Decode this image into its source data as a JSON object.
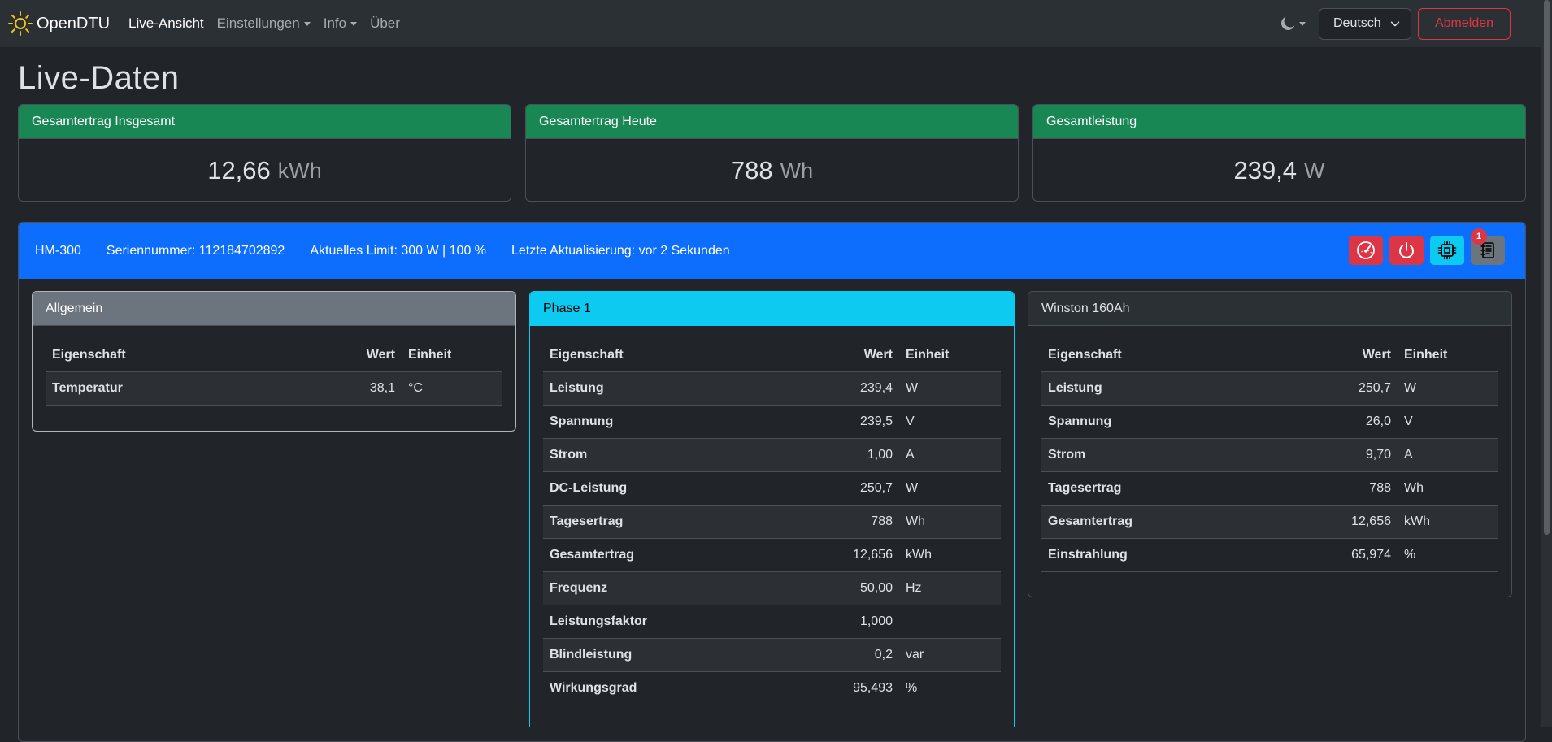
{
  "app": {
    "brand": "OpenDTU"
  },
  "nav": {
    "items": [
      {
        "label": "Live-Ansicht",
        "active": true,
        "dropdown": false
      },
      {
        "label": "Einstellungen",
        "active": false,
        "dropdown": true
      },
      {
        "label": "Info",
        "active": false,
        "dropdown": true
      },
      {
        "label": "Über",
        "active": false,
        "dropdown": false
      }
    ],
    "language": "Deutsch",
    "logout_label": "Abmelden",
    "theme_icon": "moon-icon"
  },
  "page": {
    "title": "Live-Daten"
  },
  "summary": [
    {
      "title": "Gesamtertrag Insgesamt",
      "value": "12,66",
      "unit": "kWh"
    },
    {
      "title": "Gesamtertrag Heute",
      "value": "788",
      "unit": "Wh"
    },
    {
      "title": "Gesamtleistung",
      "value": "239,4",
      "unit": "W"
    }
  ],
  "inverter": {
    "model": "HM-300",
    "serial": "Seriennummer: 112184702892",
    "limit": "Aktuelles Limit: 300 W | 100 %",
    "updated": "Letzte Aktualisierung: vor 2 Sekunden",
    "actions": [
      {
        "icon": "speedometer-icon",
        "color": "#dc3545"
      },
      {
        "icon": "power-icon",
        "color": "#dc3545"
      },
      {
        "icon": "cpu-icon",
        "color": "#0dcaf0"
      },
      {
        "icon": "journal-icon",
        "color": "#6c757d",
        "badge": "1"
      }
    ]
  },
  "cards": [
    {
      "title": "Allgemein",
      "headers": [
        "Eigenschaft",
        "Wert",
        "Einheit"
      ],
      "rows": [
        [
          "Temperatur",
          "38,1",
          "°C"
        ]
      ]
    },
    {
      "title": "Phase 1",
      "headers": [
        "Eigenschaft",
        "Wert",
        "Einheit"
      ],
      "rows": [
        [
          "Leistung",
          "239,4",
          "W"
        ],
        [
          "Spannung",
          "239,5",
          "V"
        ],
        [
          "Strom",
          "1,00",
          "A"
        ],
        [
          "DC-Leistung",
          "250,7",
          "W"
        ],
        [
          "Tagesertrag",
          "788",
          "Wh"
        ],
        [
          "Gesamtertrag",
          "12,656",
          "kWh"
        ],
        [
          "Frequenz",
          "50,00",
          "Hz"
        ],
        [
          "Leistungsfaktor",
          "1,000",
          ""
        ],
        [
          "Blindleistung",
          "0,2",
          "var"
        ],
        [
          "Wirkungsgrad",
          "95,493",
          "%"
        ]
      ]
    },
    {
      "title": "Winston 160Ah",
      "headers": [
        "Eigenschaft",
        "Wert",
        "Einheit"
      ],
      "rows": [
        [
          "Leistung",
          "250,7",
          "W"
        ],
        [
          "Spannung",
          "26,0",
          "V"
        ],
        [
          "Strom",
          "9,70",
          "A"
        ],
        [
          "Tagesertrag",
          "788",
          "Wh"
        ],
        [
          "Gesamtertrag",
          "12,656",
          "kWh"
        ],
        [
          "Einstrahlung",
          "65,974",
          "%"
        ]
      ]
    }
  ],
  "colors": {
    "success": "#198754",
    "primary": "#0d6efd",
    "info": "#0dcaf0",
    "secondary": "#6c757d",
    "danger": "#dc3545"
  }
}
